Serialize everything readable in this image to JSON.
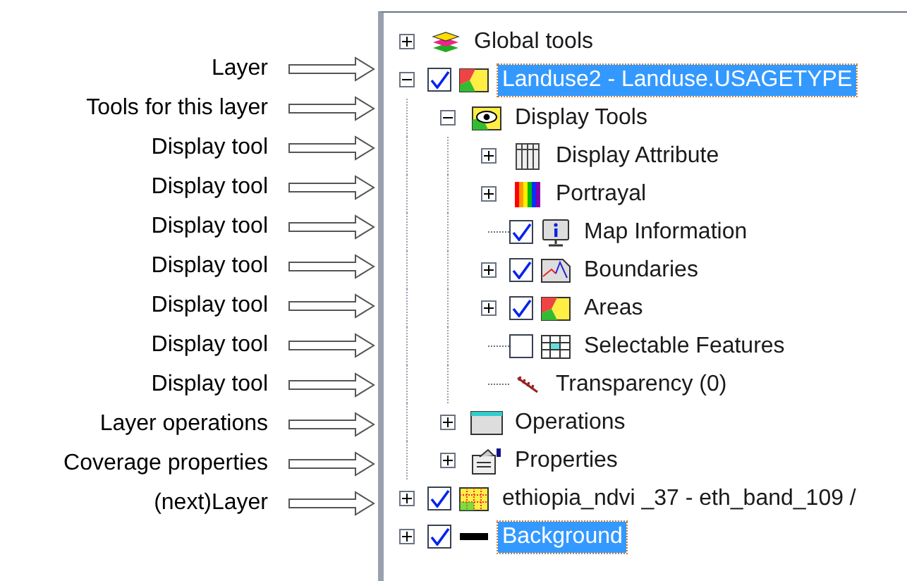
{
  "annotations": [
    {
      "label": "Layer"
    },
    {
      "label": "Tools for this layer"
    },
    {
      "label": "Display tool"
    },
    {
      "label": "Display tool"
    },
    {
      "label": "Display tool"
    },
    {
      "label": "Display tool"
    },
    {
      "label": "Display tool"
    },
    {
      "label": "Display tool"
    },
    {
      "label": "Display tool"
    },
    {
      "label": "Layer operations"
    },
    {
      "label": "Coverage properties"
    },
    {
      "label": "(next)Layer"
    }
  ],
  "tree": [
    {
      "label": "Global tools",
      "expanded": false,
      "selected": false
    },
    {
      "label": "Landuse2 - Landuse.USAGETYPE",
      "expanded": true,
      "checked": true,
      "selected": true,
      "children": [
        {
          "label": "Display Tools",
          "expanded": true,
          "selected": false,
          "children": [
            {
              "label": "Display Attribute",
              "expanded": false,
              "selected": false
            },
            {
              "label": "Portrayal",
              "expanded": false,
              "selected": false
            },
            {
              "label": "Map Information",
              "checked": true,
              "selected": false
            },
            {
              "label": "Boundaries",
              "expanded": false,
              "checked": true,
              "selected": false
            },
            {
              "label": "Areas",
              "expanded": false,
              "checked": true,
              "selected": false
            },
            {
              "label": "Selectable Features",
              "checked": false,
              "selected": false
            },
            {
              "label": "Transparency (0)",
              "selected": false
            }
          ]
        },
        {
          "label": "Operations",
          "expanded": false,
          "selected": false
        },
        {
          "label": "Properties",
          "expanded": false,
          "selected": false
        }
      ]
    },
    {
      "label": "ethiopia_ndvi _37 - eth_band_109 /",
      "expanded": false,
      "checked": true,
      "selected": false
    },
    {
      "label": "Background",
      "expanded": false,
      "checked": true,
      "selected": true
    }
  ]
}
